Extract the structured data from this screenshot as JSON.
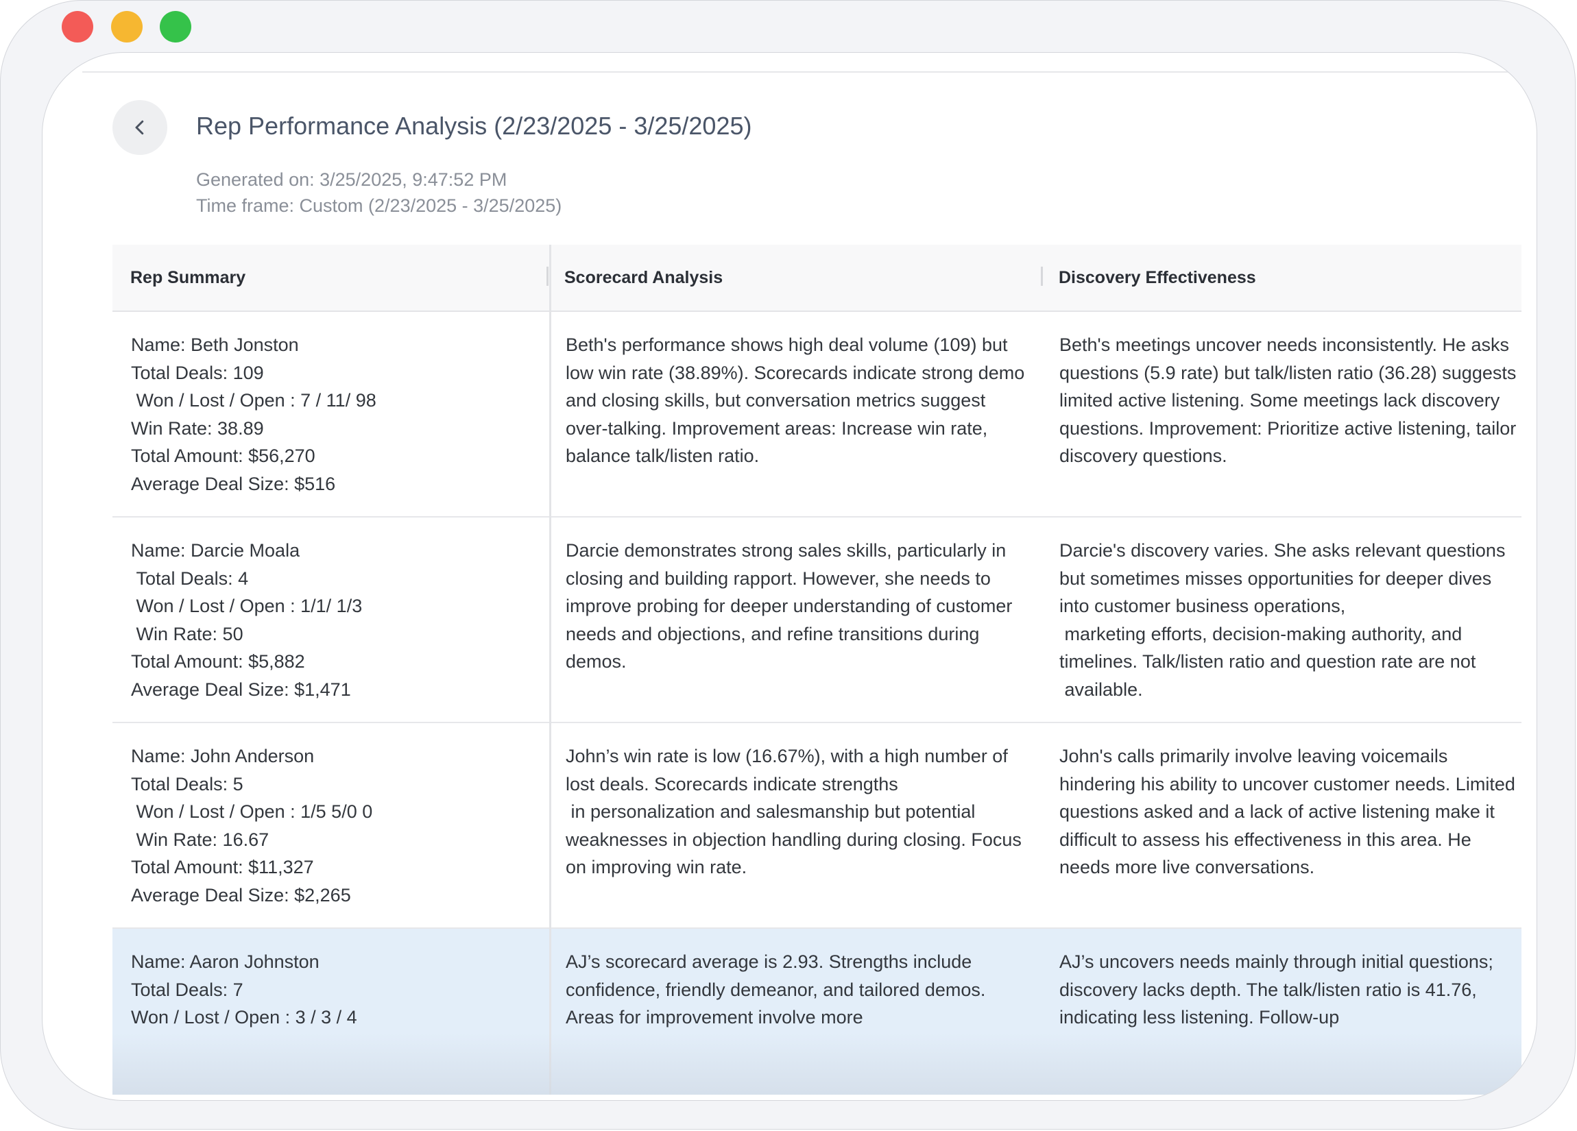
{
  "window": {
    "traffic_lights": {
      "close": "#f35b57",
      "minimize": "#f6b731",
      "maximize": "#35c24a"
    }
  },
  "header": {
    "back_icon": "chevron-left-icon",
    "title": "Rep Performance Analysis (2/23/2025 - 3/25/2025)",
    "generated": "Generated on: 3/25/2025, 9:47:52 PM",
    "time_frame": "Time frame: Custom (2/23/2025 - 3/25/2025)"
  },
  "table": {
    "columns": [
      "Rep Summary",
      "Scorecard Analysis",
      "Discovery Effectiveness"
    ],
    "rows": [
      {
        "summary": "Name: Beth Jonston\nTotal Deals: 109\n Won / Lost / Open : 7 / 11/ 98\nWin Rate: 38.89\nTotal Amount: $56,270\nAverage Deal Size: $516",
        "scorecard": "Beth's performance shows high deal volume (109) but low win rate (38.89%). Scorecards indicate strong demo and closing skills, but conversation metrics suggest over-talking. Improvement areas: Increase win rate, balance talk/listen ratio.",
        "discovery": "Beth's meetings uncover needs inconsistently. He asks questions (5.9 rate) but talk/listen ratio (36.28) suggests limited active listening. Some meetings lack discovery questions. Improvement: Prioritize active listening, tailor discovery questions."
      },
      {
        "summary": "Name: Darcie Moala\n Total Deals: 4\n Won / Lost / Open : 1/1/ 1/3\n Win Rate: 50\nTotal Amount: $5,882\nAverage Deal Size: $1,471",
        "scorecard": "Darcie demonstrates strong sales skills, particularly in closing and building rapport. However, she needs to improve probing for deeper understanding of customer needs and objections, and refine transitions during demos.",
        "discovery": "Darcie's discovery varies. She asks relevant questions but sometimes misses opportunities for deeper dives into customer business operations,\n marketing efforts, decision-making authority, and timelines. Talk/listen ratio and question rate are not\n available."
      },
      {
        "summary": "Name: John Anderson\nTotal Deals: 5\n Won / Lost / Open : 1/5 5/0 0\n Win Rate: 16.67\nTotal Amount: $11,327\nAverage Deal Size: $2,265",
        "scorecard": "John’s win rate is low (16.67%), with a high number of lost deals. Scorecards indicate strengths\n in personalization and salesmanship but potential weaknesses in objection handling during closing. Focus on improving win rate.",
        "discovery": "John's calls primarily involve leaving voicemails hindering his ability to uncover customer needs. Limited questions asked and a lack of active listening make it difficult to assess his effectiveness in this area. He needs more live conversations."
      },
      {
        "summary": "Name: Aaron Johnston\nTotal Deals: 7\nWon / Lost / Open : 3 / 3 / 4",
        "scorecard": "AJ’s scorecard average is 2.93. Strengths include confidence, friendly demeanor, and tailored demos. Areas for improvement involve more",
        "discovery": "AJ’s uncovers needs mainly through initial questions; discovery lacks depth. The talk/listen ratio is 41.76, indicating less listening. Follow-up"
      }
    ]
  }
}
